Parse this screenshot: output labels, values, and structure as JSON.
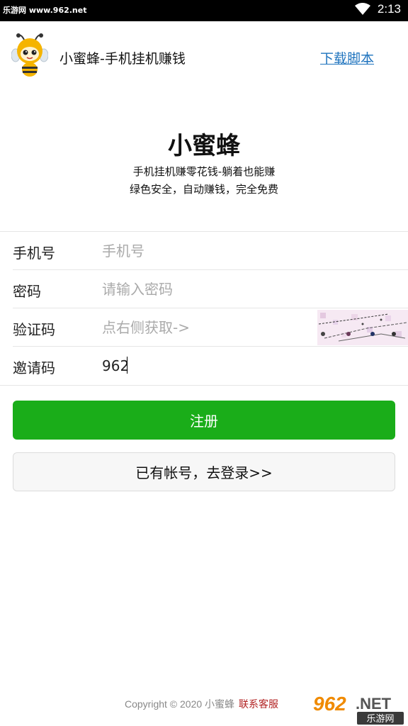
{
  "status_bar": {
    "watermark": "乐游网 www.962.net",
    "time": "2:13"
  },
  "header": {
    "app_title": "小蜜蜂-手机挂机赚钱",
    "download_link": "下载脚本"
  },
  "hero": {
    "title": "小蜜蜂",
    "line1": "手机挂机赚零花钱-躺着也能赚",
    "line2": "绿色安全，自动赚钱，完全免费"
  },
  "form": {
    "phone": {
      "label": "手机号",
      "placeholder": "手机号",
      "value": ""
    },
    "password": {
      "label": "密码",
      "placeholder": "请输入密码",
      "value": ""
    },
    "captcha": {
      "label": "验证码",
      "placeholder": "点右侧获取->",
      "value": ""
    },
    "invite": {
      "label": "邀请码",
      "placeholder": "",
      "value": "962"
    }
  },
  "buttons": {
    "register": "注册",
    "login": "已有帐号，去登录>>"
  },
  "footer": {
    "copyright": "Copyright © 2020 小蜜蜂",
    "contact": "联系客服"
  },
  "watermark_bottom": {
    "number": "962",
    "suffix": ".NET",
    "site": "乐游网"
  },
  "colors": {
    "accent_green": "#1aad19",
    "link_blue": "#1e73be",
    "contact_red": "#b22222"
  },
  "icons": {
    "logo": "bee-logo-icon",
    "wifi": "wifi-icon",
    "captcha": "captcha-image"
  }
}
